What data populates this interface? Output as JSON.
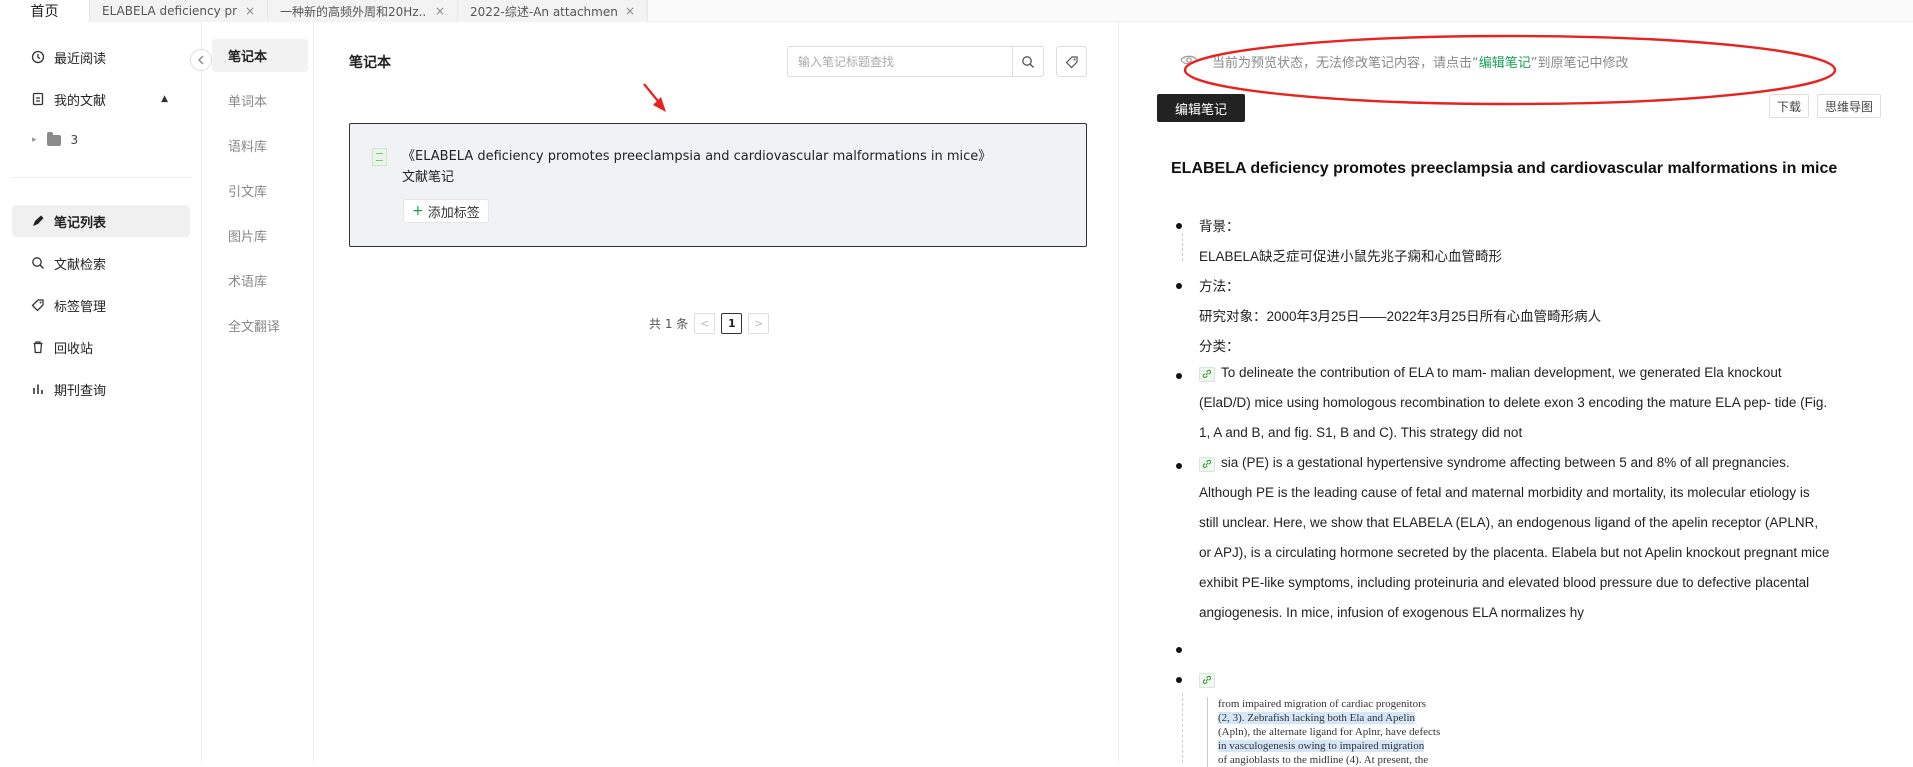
{
  "tabs": [
    {
      "label": "首页",
      "closable": false
    },
    {
      "label": "ELABELA deficiency prom...",
      "closable": true
    },
    {
      "label": "一种新的高频外周和20Hz...",
      "closable": true
    },
    {
      "label": "2022-综述-An attachmen...",
      "closable": true
    }
  ],
  "tab_close_glyph": "×",
  "leftnav": {
    "recent": "最近阅读",
    "my_docs": "我的文献",
    "folder_label": "3",
    "notes_list": "笔记列表",
    "literature_search": "文献检索",
    "tag_manage": "标签管理",
    "recycle": "回收站",
    "journal": "期刊查询"
  },
  "subnav": [
    "笔记本",
    "单词本",
    "语料库",
    "引文库",
    "图片库",
    "术语库",
    "全文翻译"
  ],
  "notebook": {
    "title": "笔记本",
    "search_placeholder": "输入笔记标题查找",
    "card_title": "《ELABELA deficiency promotes preeclampsia and cardiovascular malformations in mice》文献笔记",
    "add_tag": "添加标签",
    "add_tag_plus": "+",
    "pager_total": "共 1 条",
    "pager_prev": "<",
    "pager_page": "1",
    "pager_next": ">"
  },
  "preview": {
    "notice_prefix": "当前为预览状态，无法修改笔记内容，请点击“",
    "notice_link": "编辑笔记",
    "notice_suffix": "”到原笔记中修改",
    "edit_button": "编辑笔记",
    "download": "下载",
    "mindmap": "思维导图"
  },
  "note": {
    "title": "ELABELA deficiency promotes preeclampsia and cardiovascular malformations in mice",
    "background_label": "背景：",
    "background_text": "ELABELA缺乏症可促进小鼠先兆子痫和心血管畸形",
    "method_label": "方法：",
    "subject": "研究对象：2000年3月25日——2022年3月25日所有心血管畸形病人",
    "category": "分类：",
    "p1_l1": "To delineate the contribution of ELA to mam- malian development, we generated Ela knockout",
    "p1_l2": "(ElaD/D) mice using homologous recombination to delete exon 3 encoding the mature ELA pep- tide (Fig.",
    "p1_l3": "1, A and B, and fig. S1, B and C). This strategy did not",
    "p2_l1": "sia (PE) is a gestational hypertensive syndrome affecting between 5 and 8% of all pregnancies.",
    "p2_l2": "Although PE is the leading cause of fetal and maternal morbidity and mortality, its molecular etiology is",
    "p2_l3": "still unclear. Here, we show that ELABELA (ELA), an endogenous ligand of the apelin receptor (APLNR,",
    "p2_l4": "or APJ), is a circulating hormone secreted by the placenta. Elabela but not Apelin knockout pregnant mice",
    "p2_l5": "exhibit PE-like symptoms, including proteinuria and elevated blood pressure due to defective placental",
    "p2_l6": "angiogenesis. In mice, infusion of exogenous ELA normalizes hy",
    "excerpt": [
      "from impaired migration of cardiac progenitors",
      "(2, 3). Zebrafish lacking both Ela and Apelin",
      "(Apln), the alternate ligand for Aplnr, have defects",
      "in vasculogenesis owing to impaired migration",
      "of angioblasts to the midline (4). At present, the"
    ]
  },
  "colors": {
    "accent_green": "#18a058",
    "annotation_red": "#e8231f",
    "dark_button": "#222222"
  }
}
